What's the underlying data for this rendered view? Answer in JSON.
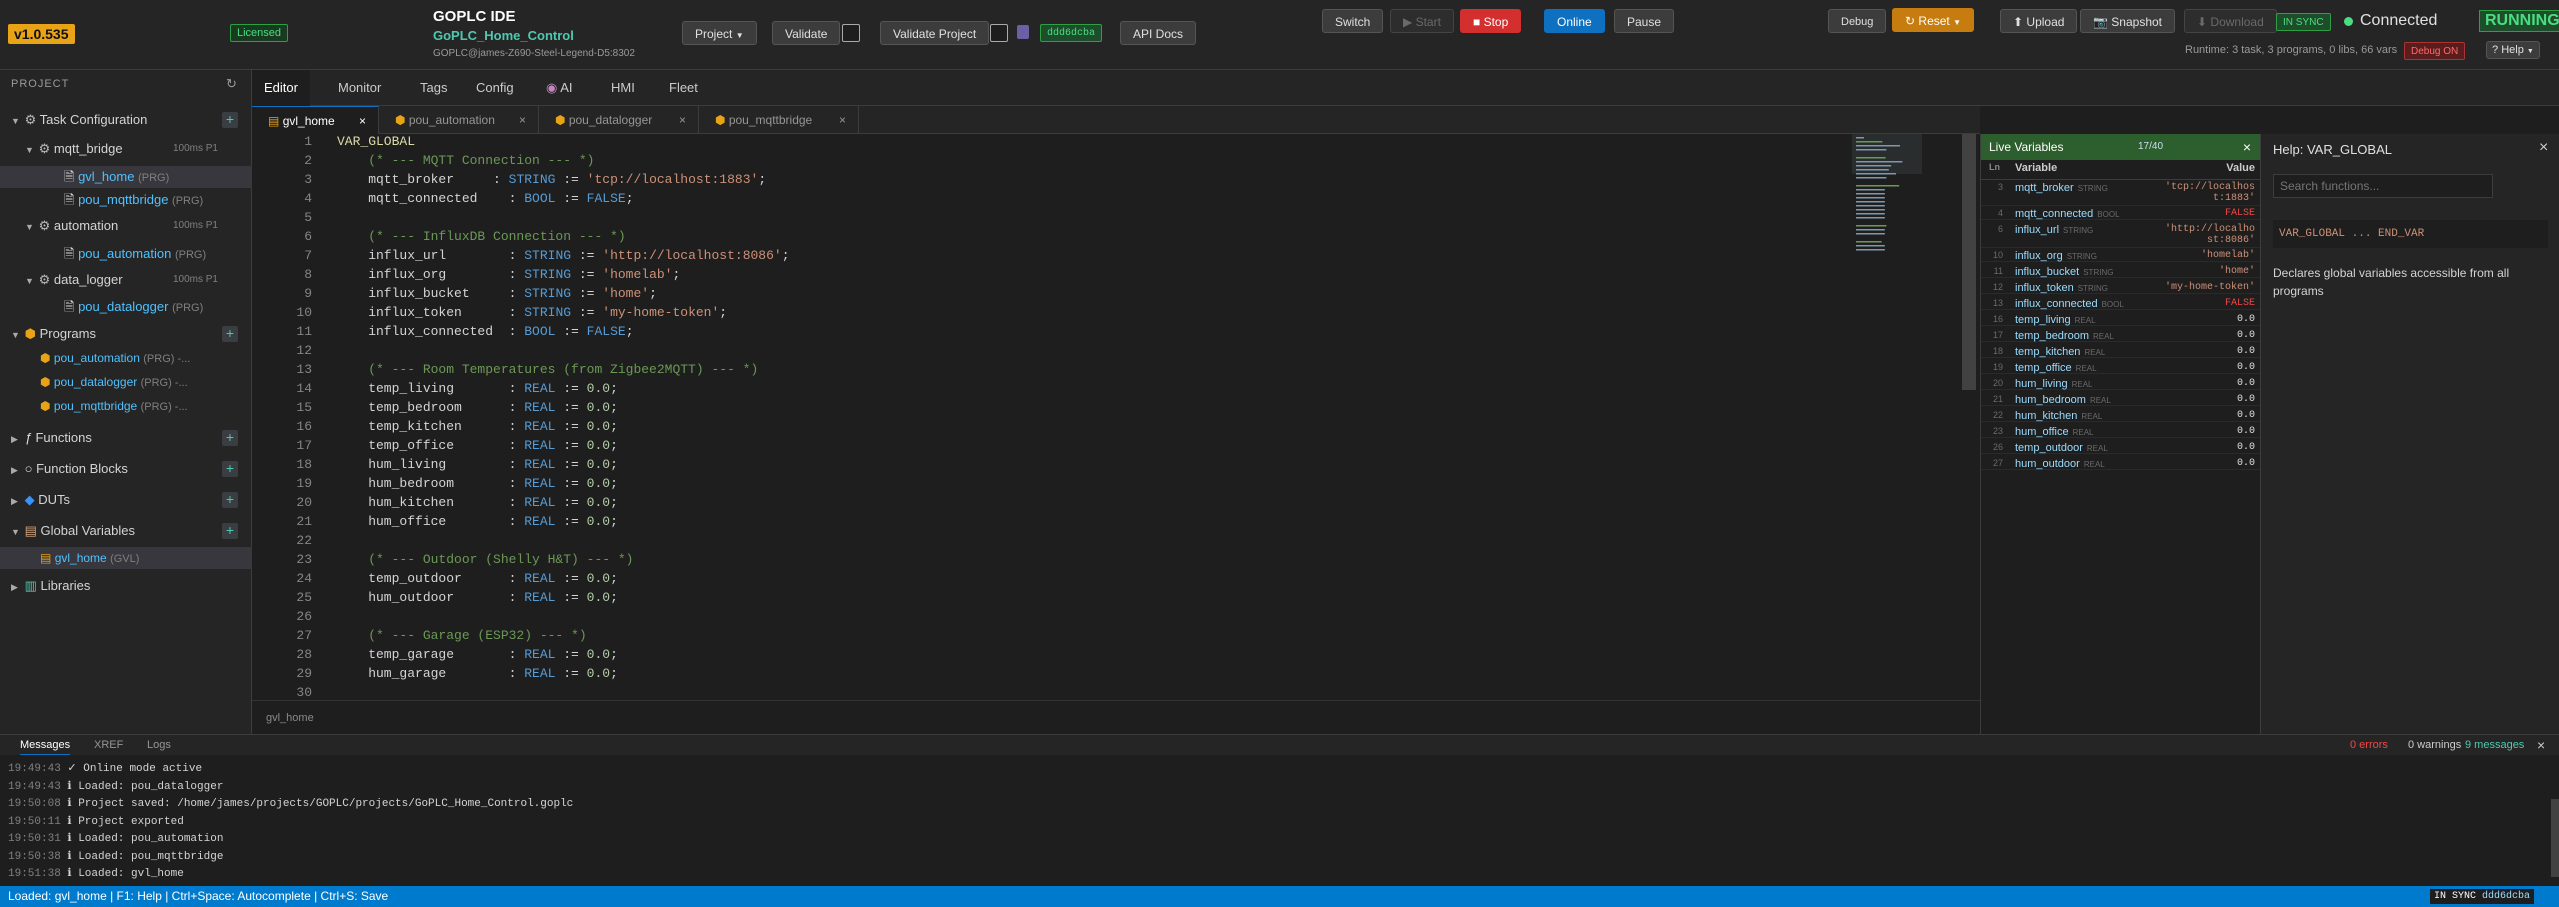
{
  "header": {
    "version": "v1.0.535",
    "licensed": "Licensed",
    "app_title": "GOPLC IDE",
    "project_name": "GoPLC_Home_Control",
    "host": "GOPLC@james-Z690-Steel-Legend-D5:8302",
    "project_btn": "Project",
    "validate_btn": "Validate",
    "validate_project_btn": "Validate Project",
    "hash": "ddd6dcba",
    "api_docs_btn": "API Docs",
    "switch_btn": "Switch",
    "start_btn": "Start",
    "stop_btn": "Stop",
    "online_btn": "Online",
    "pause_btn": "Pause",
    "debug_btn": "Debug",
    "reset_btn": "Reset",
    "upload_btn": "Upload",
    "snapshot_btn": "Snapshot",
    "download_btn": "Download",
    "in_sync": "IN SYNC",
    "connected": "Connected",
    "running": "RUNNING",
    "runtime_info": "Runtime: 3 task, 3 programs, 0 libs, 66 vars",
    "debug_on": "Debug ON",
    "help_btn": "Help"
  },
  "sidebar": {
    "title": "PROJECT",
    "task_config": "Task Configuration",
    "tasks": [
      {
        "name": "mqtt_bridge",
        "prio": "100ms P1",
        "items": [
          {
            "label": "gvl_home",
            "suffix": "(PRG)"
          },
          {
            "label": "pou_mqttbridge",
            "suffix": "(PRG)"
          }
        ]
      },
      {
        "name": "automation",
        "prio": "100ms P1",
        "items": [
          {
            "label": "pou_automation",
            "suffix": "(PRG)"
          }
        ]
      },
      {
        "name": "data_logger",
        "prio": "100ms P1",
        "items": [
          {
            "label": "pou_datalogger",
            "suffix": "(PRG)"
          }
        ]
      }
    ],
    "programs_label": "Programs",
    "programs": [
      {
        "label": "pou_automation",
        "suffix": "(PRG) -..."
      },
      {
        "label": "pou_datalogger",
        "suffix": "(PRG) -..."
      },
      {
        "label": "pou_mqttbridge",
        "suffix": "(PRG) -..."
      }
    ],
    "functions_label": "Functions",
    "function_blocks_label": "Function Blocks",
    "duts_label": "DUTs",
    "global_vars_label": "Global Variables",
    "gvl_item": {
      "label": "gvl_home",
      "suffix": "(GVL)"
    },
    "libraries_label": "Libraries"
  },
  "main_tabs": [
    "Editor",
    "Monitor",
    "Tags",
    "Config",
    "AI",
    "HMI",
    "Fleet"
  ],
  "file_tabs": [
    "gvl_home",
    "pou_automation",
    "pou_datalogger",
    "pou_mqttbridge"
  ],
  "editor": {
    "breadcrumb": "gvl_home",
    "lines": [
      [
        [
          "VAR_GLOBAL",
          "vg"
        ]
      ],
      [
        [
          "    (* --- MQTT Connection --- *)",
          "cm"
        ]
      ],
      [
        [
          "    mqtt_broker     : ",
          ""
        ],
        [
          "STRING",
          "kw"
        ],
        [
          " := ",
          ""
        ],
        [
          "'tcp://localhost:1883'",
          "str"
        ],
        [
          ";",
          ""
        ]
      ],
      [
        [
          "    mqtt_connected    : ",
          ""
        ],
        [
          "BOOL",
          "kw"
        ],
        [
          " := ",
          ""
        ],
        [
          "FALSE",
          "kw"
        ],
        [
          ";",
          ""
        ]
      ],
      [
        [
          "",
          ""
        ]
      ],
      [
        [
          "    (* --- InfluxDB Connection --- *)",
          "cm"
        ]
      ],
      [
        [
          "    influx_url        : ",
          ""
        ],
        [
          "STRING",
          "kw"
        ],
        [
          " := ",
          ""
        ],
        [
          "'http://localhost:8086'",
          "str"
        ],
        [
          ";",
          ""
        ]
      ],
      [
        [
          "    influx_org        : ",
          ""
        ],
        [
          "STRING",
          "kw"
        ],
        [
          " := ",
          ""
        ],
        [
          "'homelab'",
          "str"
        ],
        [
          ";",
          ""
        ]
      ],
      [
        [
          "    influx_bucket     : ",
          ""
        ],
        [
          "STRING",
          "kw"
        ],
        [
          " := ",
          ""
        ],
        [
          "'home'",
          "str"
        ],
        [
          ";",
          ""
        ]
      ],
      [
        [
          "    influx_token      : ",
          ""
        ],
        [
          "STRING",
          "kw"
        ],
        [
          " := ",
          ""
        ],
        [
          "'my-home-token'",
          "str"
        ],
        [
          ";",
          ""
        ]
      ],
      [
        [
          "    influx_connected  : ",
          ""
        ],
        [
          "BOOL",
          "kw"
        ],
        [
          " := ",
          ""
        ],
        [
          "FALSE",
          "kw"
        ],
        [
          ";",
          ""
        ]
      ],
      [
        [
          "",
          ""
        ]
      ],
      [
        [
          "    (* --- Room Temperatures (from Zigbee2MQTT) --- *)",
          "cm"
        ]
      ],
      [
        [
          "    temp_living       : ",
          ""
        ],
        [
          "REAL",
          "kw"
        ],
        [
          " := ",
          ""
        ],
        [
          "0.0",
          "num"
        ],
        [
          ";",
          ""
        ]
      ],
      [
        [
          "    temp_bedroom      : ",
          ""
        ],
        [
          "REAL",
          "kw"
        ],
        [
          " := ",
          ""
        ],
        [
          "0.0",
          "num"
        ],
        [
          ";",
          ""
        ]
      ],
      [
        [
          "    temp_kitchen      : ",
          ""
        ],
        [
          "REAL",
          "kw"
        ],
        [
          " := ",
          ""
        ],
        [
          "0.0",
          "num"
        ],
        [
          ";",
          ""
        ]
      ],
      [
        [
          "    temp_office       : ",
          ""
        ],
        [
          "REAL",
          "kw"
        ],
        [
          " := ",
          ""
        ],
        [
          "0.0",
          "num"
        ],
        [
          ";",
          ""
        ]
      ],
      [
        [
          "    hum_living        : ",
          ""
        ],
        [
          "REAL",
          "kw"
        ],
        [
          " := ",
          ""
        ],
        [
          "0.0",
          "num"
        ],
        [
          ";",
          ""
        ]
      ],
      [
        [
          "    hum_bedroom       : ",
          ""
        ],
        [
          "REAL",
          "kw"
        ],
        [
          " := ",
          ""
        ],
        [
          "0.0",
          "num"
        ],
        [
          ";",
          ""
        ]
      ],
      [
        [
          "    hum_kitchen       : ",
          ""
        ],
        [
          "REAL",
          "kw"
        ],
        [
          " := ",
          ""
        ],
        [
          "0.0",
          "num"
        ],
        [
          ";",
          ""
        ]
      ],
      [
        [
          "    hum_office        : ",
          ""
        ],
        [
          "REAL",
          "kw"
        ],
        [
          " := ",
          ""
        ],
        [
          "0.0",
          "num"
        ],
        [
          ";",
          ""
        ]
      ],
      [
        [
          "",
          ""
        ]
      ],
      [
        [
          "    (* --- Outdoor (Shelly H&T) --- *)",
          "cm"
        ]
      ],
      [
        [
          "    temp_outdoor      : ",
          ""
        ],
        [
          "REAL",
          "kw"
        ],
        [
          " := ",
          ""
        ],
        [
          "0.0",
          "num"
        ],
        [
          ";",
          ""
        ]
      ],
      [
        [
          "    hum_outdoor       : ",
          ""
        ],
        [
          "REAL",
          "kw"
        ],
        [
          " := ",
          ""
        ],
        [
          "0.0",
          "num"
        ],
        [
          ";",
          ""
        ]
      ],
      [
        [
          "",
          ""
        ]
      ],
      [
        [
          "    (* --- Garage (ESP32) --- *)",
          "cm"
        ]
      ],
      [
        [
          "    temp_garage       : ",
          ""
        ],
        [
          "REAL",
          "kw"
        ],
        [
          " := ",
          ""
        ],
        [
          "0.0",
          "num"
        ],
        [
          ";",
          ""
        ]
      ],
      [
        [
          "    hum_garage        : ",
          ""
        ],
        [
          "REAL",
          "kw"
        ],
        [
          " := ",
          ""
        ],
        [
          "0.0",
          "num"
        ],
        [
          ";",
          ""
        ]
      ],
      [
        [
          "",
          ""
        ]
      ]
    ]
  },
  "live_vars": {
    "title": "Live Variables",
    "count": "17/40",
    "col_ln": "Ln",
    "col_var": "Variable",
    "col_val": "Value",
    "rows": [
      {
        "ln": "3",
        "name": "mqtt_broker",
        "type": "STRING",
        "value": "'tcp://localhost:1883'",
        "color": "#ce9178"
      },
      {
        "ln": "4",
        "name": "mqtt_connected",
        "type": "BOOL",
        "value": "FALSE",
        "color": "#f44747"
      },
      {
        "ln": "6",
        "name": "influx_url",
        "type": "STRING",
        "value": "'http://localhost:8086'",
        "color": "#ce9178"
      },
      {
        "ln": "10",
        "name": "influx_org",
        "type": "STRING",
        "value": "'homelab'",
        "color": "#ce9178"
      },
      {
        "ln": "11",
        "name": "influx_bucket",
        "type": "STRING",
        "value": "'home'",
        "color": "#ce9178"
      },
      {
        "ln": "12",
        "name": "influx_token",
        "type": "STRING",
        "value": "'my-home-token'",
        "color": "#ce9178"
      },
      {
        "ln": "13",
        "name": "influx_connected",
        "type": "BOOL",
        "value": "FALSE",
        "color": "#f44747"
      },
      {
        "ln": "16",
        "name": "temp_living",
        "type": "REAL",
        "value": "0.0",
        "color": "#e0e0e0"
      },
      {
        "ln": "17",
        "name": "temp_bedroom",
        "type": "REAL",
        "value": "0.0",
        "color": "#e0e0e0"
      },
      {
        "ln": "18",
        "name": "temp_kitchen",
        "type": "REAL",
        "value": "0.0",
        "color": "#e0e0e0"
      },
      {
        "ln": "19",
        "name": "temp_office",
        "type": "REAL",
        "value": "0.0",
        "color": "#e0e0e0"
      },
      {
        "ln": "20",
        "name": "hum_living",
        "type": "REAL",
        "value": "0.0",
        "color": "#e0e0e0"
      },
      {
        "ln": "21",
        "name": "hum_bedroom",
        "type": "REAL",
        "value": "0.0",
        "color": "#e0e0e0"
      },
      {
        "ln": "22",
        "name": "hum_kitchen",
        "type": "REAL",
        "value": "0.0",
        "color": "#e0e0e0"
      },
      {
        "ln": "23",
        "name": "hum_office",
        "type": "REAL",
        "value": "0.0",
        "color": "#e0e0e0"
      },
      {
        "ln": "26",
        "name": "temp_outdoor",
        "type": "REAL",
        "value": "0.0",
        "color": "#e0e0e0"
      },
      {
        "ln": "27",
        "name": "hum_outdoor",
        "type": "REAL",
        "value": "0.0",
        "color": "#e0e0e0"
      }
    ]
  },
  "help": {
    "title": "Help: VAR_GLOBAL",
    "search_placeholder": "Search functions...",
    "syntax": "VAR_GLOBAL ... END_VAR",
    "description": "Declares global variables accessible from all programs"
  },
  "messages": {
    "tabs": [
      "Messages",
      "XREF",
      "Logs"
    ],
    "errors": "0 errors",
    "warnings": "0 warnings",
    "count": "9 messages",
    "lines": [
      {
        "t": "19:49:43",
        "m": "✓ Online mode active"
      },
      {
        "t": "19:49:43",
        "m": "ℹ Loaded: pou_datalogger"
      },
      {
        "t": "19:50:08",
        "m": "ℹ Project saved: /home/james/projects/GOPLC/projects/GoPLC_Home_Control.goplc"
      },
      {
        "t": "19:50:11",
        "m": "ℹ Project exported"
      },
      {
        "t": "19:50:31",
        "m": "ℹ Loaded: pou_automation"
      },
      {
        "t": "19:50:38",
        "m": "ℹ Loaded: pou_mqttbridge"
      },
      {
        "t": "19:51:38",
        "m": "ℹ Loaded: gvl_home"
      }
    ]
  },
  "statusbar": {
    "text": "Loaded: gvl_home | F1: Help | Ctrl+Space: Autocomplete | Ctrl+S: Save",
    "sync": "IN SYNC",
    "hash": "ddd6dcba"
  }
}
